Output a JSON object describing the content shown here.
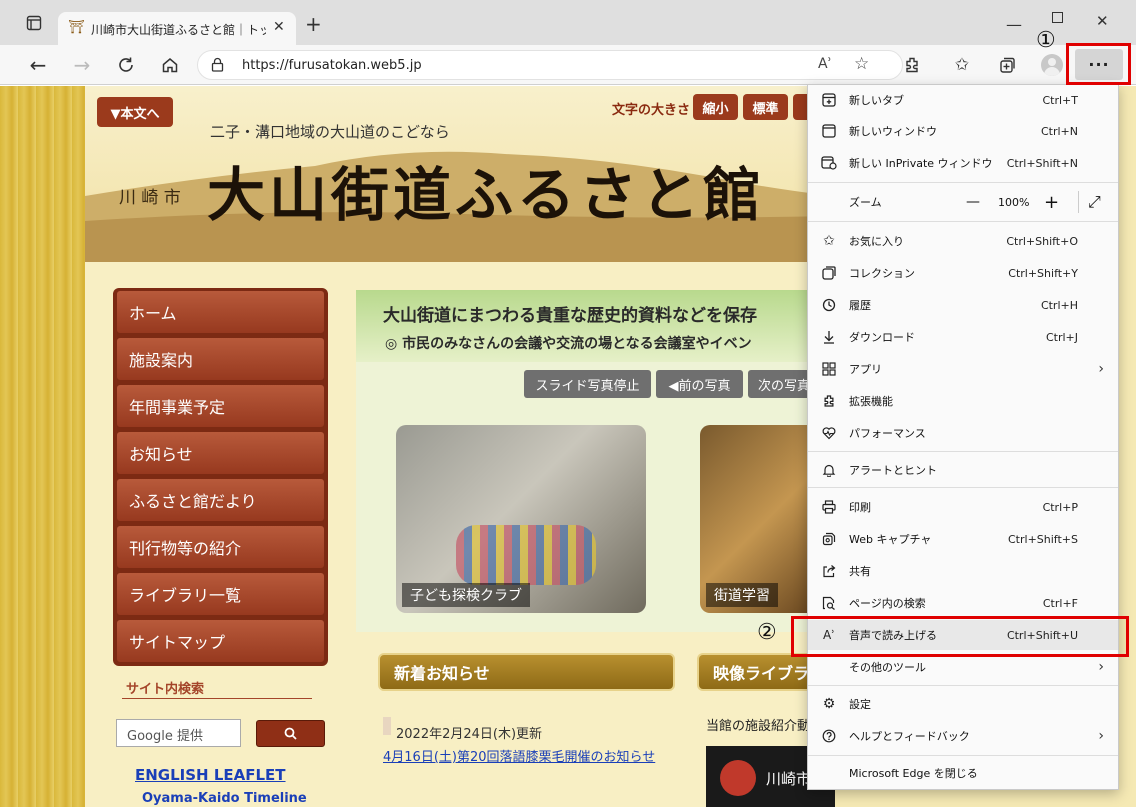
{
  "browser": {
    "tab_title": "川崎市大山街道ふるさと館｜トップ",
    "url": "https://furusatokan.web5.jp",
    "read_aloud_glyph": "Aʾ"
  },
  "site": {
    "skip_button": "▼本文へ",
    "tagline": "二子・溝口地域の大山道のこどなら",
    "city": "川 崎 市",
    "logo_title": "大山街道ふるさと館",
    "font_size_label": "文字の大きさ",
    "font_small": "縮小",
    "font_standard": "標準",
    "nav": [
      "ホーム",
      "施設案内",
      "年間事業予定",
      "お知らせ",
      "ふるさと館だより",
      "刊行物等の紹介",
      "ライブラリ一覧",
      "サイトマップ"
    ],
    "search_title": "サイト内検索",
    "search_placeholder": "Google 提供",
    "english_leaflet": "ENGLISH LEAFLET",
    "timeline_link": "Oyama-Kaido Timeline",
    "hero_line1": "大山街道にまつわる貴重な歴史的資料などを保存",
    "hero_line2": "◎ 市民のみなさんの会議や交流の場となる会議室やイベン",
    "slide_stop": "スライド写真停止",
    "prev_photo": "◀前の写真",
    "next_photo": "次の写真",
    "photo1_caption": "子ども探検クラブ",
    "photo2_caption": "街道学習",
    "news_title": "新着お知らせ",
    "video_title": "映像ライブラ",
    "news_date": "2022年2月24日(木)更新",
    "news_link": "4月16日(土)第20回落語膝栗毛開催のお知らせ",
    "video_text": "当館の施設紹介動",
    "video_overlay": "川崎市大山街道ふるさと館"
  },
  "menu": {
    "items": [
      {
        "label": "新しいタブ",
        "shortcut": "Ctrl+T",
        "icon": "new-tab-icon"
      },
      {
        "label": "新しいウィンドウ",
        "shortcut": "Ctrl+N",
        "icon": "new-window-icon"
      },
      {
        "label": "新しい InPrivate ウィンドウ",
        "shortcut": "Ctrl+Shift+N",
        "icon": "inprivate-icon"
      },
      {
        "label": "お気に入り",
        "shortcut": "Ctrl+Shift+O",
        "icon": "favorites-icon"
      },
      {
        "label": "コレクション",
        "shortcut": "Ctrl+Shift+Y",
        "icon": "collections-icon"
      },
      {
        "label": "履歴",
        "shortcut": "Ctrl+H",
        "icon": "history-icon"
      },
      {
        "label": "ダウンロード",
        "shortcut": "Ctrl+J",
        "icon": "download-icon"
      },
      {
        "label": "アプリ",
        "shortcut": "",
        "icon": "apps-icon"
      },
      {
        "label": "拡張機能",
        "shortcut": "",
        "icon": "extensions-icon"
      },
      {
        "label": "パフォーマンス",
        "shortcut": "",
        "icon": "performance-icon"
      },
      {
        "label": "アラートとヒント",
        "shortcut": "",
        "icon": "bell-icon"
      },
      {
        "label": "印刷",
        "shortcut": "Ctrl+P",
        "icon": "print-icon"
      },
      {
        "label": "Web キャプチャ",
        "shortcut": "Ctrl+Shift+S",
        "icon": "web-capture-icon"
      },
      {
        "label": "共有",
        "shortcut": "",
        "icon": "share-icon"
      },
      {
        "label": "ページ内の検索",
        "shortcut": "Ctrl+F",
        "icon": "find-icon"
      },
      {
        "label": "音声で読み上げる",
        "shortcut": "Ctrl+Shift+U",
        "icon": "read-aloud-icon"
      },
      {
        "label": "その他のツール",
        "shortcut": "",
        "icon": "more-tools-icon"
      },
      {
        "label": "設定",
        "shortcut": "",
        "icon": "settings-icon"
      },
      {
        "label": "ヘルプとフィードバック",
        "shortcut": "",
        "icon": "help-icon"
      },
      {
        "label": "Microsoft Edge を閉じる",
        "shortcut": "",
        "icon": "close-edge-icon"
      }
    ],
    "zoom_label": "ズーム",
    "zoom_minus": "—",
    "zoom_value": "100%",
    "zoom_plus": "+",
    "fullscreen_glyph": "⤢"
  },
  "annotations": {
    "step1": "①",
    "step2": "②"
  },
  "colors": {
    "highlight": "#e00000",
    "nav_brown": "#a4452a"
  }
}
